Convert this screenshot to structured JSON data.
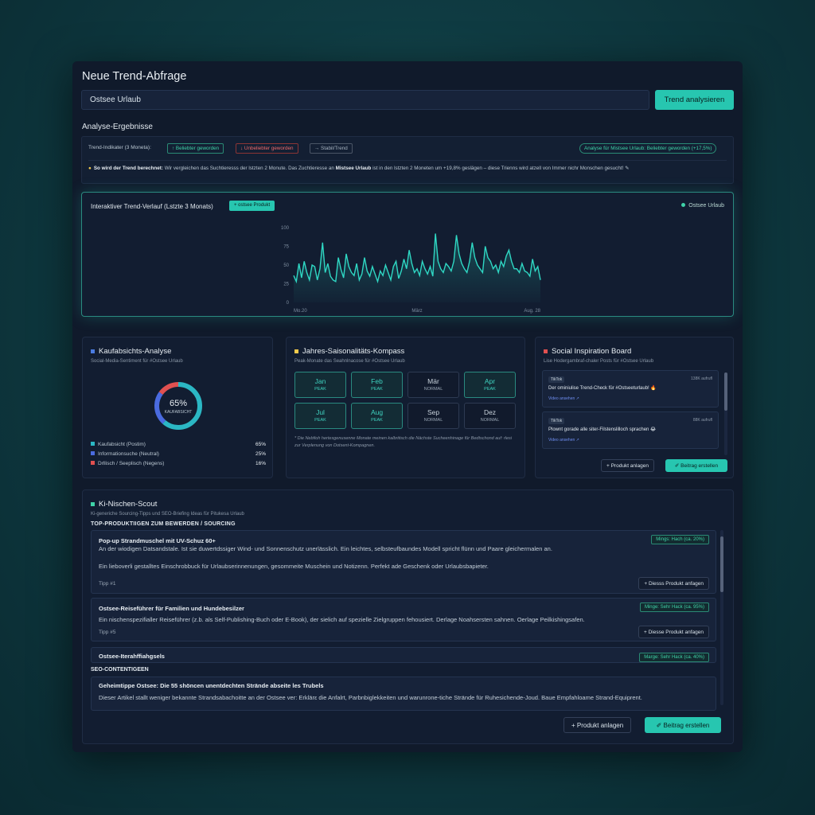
{
  "header": {
    "title": "Neue Trend-Abfrage",
    "search_value": "Ostsee Urlaub",
    "analyze_label": "Trend analysieren"
  },
  "results": {
    "title": "Analyse-Ergebnisse",
    "indicator_label": "Trend-Indikater (3 Moneta):",
    "chip_up": "↑ Beliebter geworden",
    "chip_down": "↓ Unbeliebter geworden",
    "chip_stable": "→ Stabil/Trend",
    "analysis_chip": "Analyse für Mistsee Urlaub: Beliebter geworden (+17,5%)",
    "explain_bold": "So wird der Trend berechnet:",
    "explain_text_1": "Wir vergleichen das Suchtieresss der lstzten 2 Monute. Das Zuchtieresse an",
    "explain_term": "Mistsee Urlaub",
    "explain_text_2": "ist in den lstzten 2 Moneten um +19,8% geslägen – diese Trienns wird atzell von Immer nichr Monschen gesucht!",
    "explain_icon": "✎"
  },
  "chart": {
    "title": "Interaktiver Trend-Verlauf (Lstzte 3 Monats)",
    "chip": "+ ostsee Produkt",
    "legend": "Ostsee Urlaub"
  },
  "chart_data": {
    "type": "area",
    "title": "Interaktiver Trend-Verlauf (Lstzte 3 Monats)",
    "x_tick_labels": [
      "Mo.20",
      "März",
      "Aug. 28"
    ],
    "y_ticks": [
      0,
      25,
      50,
      75,
      100
    ],
    "ylim": [
      0,
      100
    ],
    "series": [
      {
        "name": "Ostsee Urlaub",
        "values": [
          36,
          28,
          52,
          33,
          55,
          40,
          30,
          50,
          48,
          30,
          45,
          80,
          40,
          52,
          35,
          30,
          28,
          60,
          44,
          33,
          65,
          48,
          40,
          36,
          52,
          30,
          38,
          60,
          42,
          35,
          48,
          38,
          28,
          42,
          36,
          50,
          40,
          30,
          48,
          55,
          32,
          42,
          58,
          45,
          70,
          52,
          40,
          45,
          36,
          55,
          45,
          38,
          48,
          35,
          92,
          55,
          45,
          40,
          52,
          48,
          42,
          55,
          90,
          65,
          52,
          45,
          40,
          55,
          80,
          60,
          50,
          45,
          40,
          75,
          60,
          55,
          45,
          50,
          40,
          55,
          48,
          62,
          70,
          55,
          45,
          45,
          40,
          52,
          42,
          40,
          35,
          58,
          42,
          48,
          30
        ]
      }
    ],
    "grid": false,
    "legend_position": "top-right"
  },
  "purchase": {
    "title": "Kaufabsichts-Analyse",
    "subtitle": "Social-Media-Sentiment für #Ostsee Urlaub",
    "donut_pct": "65%",
    "donut_label": "KAUFABSICHT",
    "donut_values": {
      "positive": 65,
      "neutral": 25,
      "negative": 16
    },
    "legend": [
      {
        "label": "Kaufabsicht (Postim)",
        "value": "65%",
        "color": "#2bb7c4"
      },
      {
        "label": "Informationsuche (Neutral)",
        "value": "25%",
        "color": "#4a6be0"
      },
      {
        "label": "Drllisch / Seeplisch (Negens)",
        "value": "16%",
        "color": "#e05050"
      }
    ]
  },
  "season": {
    "title": "Jahres-Saisonalitäts-Kompass",
    "subtitle": "Peak-Monate das Seahnlnacose für #Ostsee Urlaub",
    "months": [
      {
        "name": "Jan",
        "status": "PEAK"
      },
      {
        "name": "Feb",
        "status": "PEAK"
      },
      {
        "name": "Mär",
        "status": "NORMAL"
      },
      {
        "name": "Apr",
        "status": "PEAK"
      },
      {
        "name": "Jul",
        "status": "PEAK"
      },
      {
        "name": "Aug",
        "status": "PEAK"
      },
      {
        "name": "Sep",
        "status": "NORMAL"
      },
      {
        "name": "Dez",
        "status": "NORMAL"
      }
    ],
    "note": "* Die Nebfioh hertesgenusenne Monate meinen kalbritisch die Nächste Sucheenhinage für Bedtschond auf: rlesi zur Verplenung von Dotsent-Kompagnen."
  },
  "social": {
    "title": "Social Inspiration Board",
    "subtitle": "Lise Hodergambraf-chaler Posts für #Ostsee Urlaub",
    "posts": [
      {
        "source": "TikTok",
        "count": "138K aufrufl",
        "text": "Der ominiulise Trend-Check für #Ostseeturlaub! 🔥",
        "link": "Video ansehen ↗"
      },
      {
        "source": "TikTok",
        "count": "88K aufrufl",
        "text": "Plownt gorade alle siter-Filstenslilloch sprachen 😂",
        "link": "Video ansehen ↗"
      }
    ],
    "btn_product": "+ Produkt anlagen",
    "btn_post": "✐ Beitrag erstellen"
  },
  "scout": {
    "title": "Ki-Nischen-Scout",
    "subtitle": "Ki-generiche Sourcing-Tipps und SEO-Briefing Ideas für Pitukesa Urlaub",
    "products_heading": "TOP-PRODUKTIIGEN ZUM BEWERDEN / SOURCING",
    "cards": [
      {
        "title": "Pop-up Strandmuschel mit UV-Schuz 60+",
        "desc1": "An der wiodigen Datsandstale. Ist sie duwertdssiger Wind- und Sonnenschutz unerlässlich. Ein leichtes, selbsteufbaundes Modell spricht flünn und Paare gleichermalen an.",
        "desc2": "Ein lieboverli gestalltes Einschrobbuck für Urlaubserinnenungen, gesommeite Muschein und Notizenn. Perfekt ade Geschenk oder Urlaubsbapieter.",
        "tip": "Tipp #1",
        "badge": "Mings: Hach (ca. 20%)",
        "button": "+ Diesss Produkt anfagen"
      },
      {
        "title": "Ostsee-Reiseführer für Familien und Hundebesilzer",
        "desc1": "Ein nischenspezifialler Reiseführer (z.b. als Self-Publishing-Buch oder E-Book), der sielich auf spezielle Zielgruppen fehousiert. Derlage Noahsersten sahnen. Oerlage Peilkishingsafen.",
        "tip": "Tipp #5",
        "badge": "Minge: Sehr Hack (ca. 95%)",
        "button": "+ Diesse Produkt anfagen"
      },
      {
        "title": "Ostsee-Iterahffiahgsels",
        "badge": "Marge: Sehr Hack (ca. 40%)"
      }
    ],
    "seo_heading": "SEO-CONTENTIGEEN",
    "seo_title": "Geheimtippe Ostsee: Die 55 shöncen unentdechten Strände abseite les Trubels",
    "seo_desc": "Dieser Artikel stallt weniger bekannte Strandsabachoitte an der Ostsee ver: Erklärε die Anfalrt, Parbnbiglekkeiten und warunrone-tiche Strände für Ruhesichende-Joud. Baue Empfahloame Strand-Equiprent.",
    "btn_product": "+ Produkt anlagen",
    "btn_post": "✐ Beitrag erstellen"
  }
}
